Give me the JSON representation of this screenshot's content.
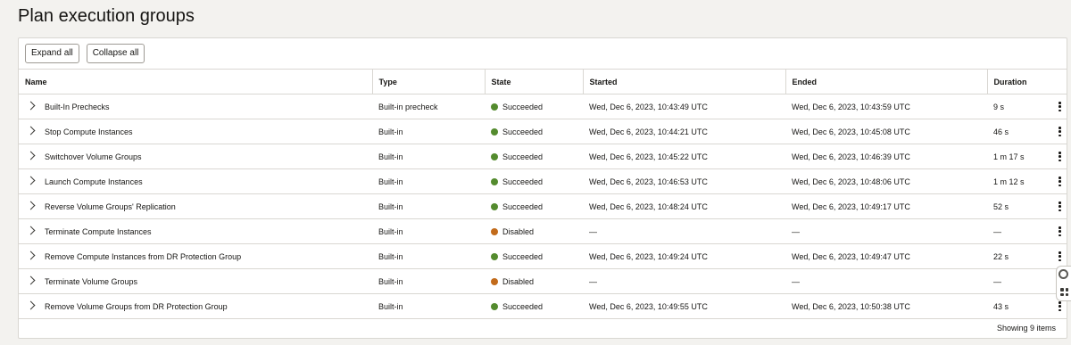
{
  "page": {
    "title": "Plan execution groups"
  },
  "toolbar": {
    "expand_all": "Expand all",
    "collapse_all": "Collapse all"
  },
  "columns": [
    "Name",
    "Type",
    "State",
    "Started",
    "Ended",
    "Duration"
  ],
  "colors": {
    "succeeded": "#548b2e",
    "disabled": "#c26b1b"
  },
  "icons": {
    "expand": "chevron-right-icon",
    "actions": "kebab-menu-icon"
  },
  "rows": [
    {
      "name": "Built-In Prechecks",
      "type": "Built-in precheck",
      "state": "Succeeded",
      "status": "succeeded",
      "started": "Wed, Dec 6, 2023, 10:43:49 UTC",
      "ended": "Wed, Dec 6, 2023, 10:43:59 UTC",
      "duration": "9 s"
    },
    {
      "name": "Stop Compute Instances",
      "type": "Built-in",
      "state": "Succeeded",
      "status": "succeeded",
      "started": "Wed, Dec 6, 2023, 10:44:21 UTC",
      "ended": "Wed, Dec 6, 2023, 10:45:08 UTC",
      "duration": "46 s"
    },
    {
      "name": "Switchover Volume Groups",
      "type": "Built-in",
      "state": "Succeeded",
      "status": "succeeded",
      "started": "Wed, Dec 6, 2023, 10:45:22 UTC",
      "ended": "Wed, Dec 6, 2023, 10:46:39 UTC",
      "duration": "1 m 17 s"
    },
    {
      "name": "Launch Compute Instances",
      "type": "Built-in",
      "state": "Succeeded",
      "status": "succeeded",
      "started": "Wed, Dec 6, 2023, 10:46:53 UTC",
      "ended": "Wed, Dec 6, 2023, 10:48:06 UTC",
      "duration": "1 m 12 s"
    },
    {
      "name": "Reverse Volume Groups' Replication",
      "type": "Built-in",
      "state": "Succeeded",
      "status": "succeeded",
      "started": "Wed, Dec 6, 2023, 10:48:24 UTC",
      "ended": "Wed, Dec 6, 2023, 10:49:17 UTC",
      "duration": "52 s"
    },
    {
      "name": "Terminate Compute Instances",
      "type": "Built-in",
      "state": "Disabled",
      "status": "disabled",
      "started": "—",
      "ended": "—",
      "duration": "—"
    },
    {
      "name": "Remove Compute Instances from DR Protection Group",
      "type": "Built-in",
      "state": "Succeeded",
      "status": "succeeded",
      "started": "Wed, Dec 6, 2023, 10:49:24 UTC",
      "ended": "Wed, Dec 6, 2023, 10:49:47 UTC",
      "duration": "22 s"
    },
    {
      "name": "Terminate Volume Groups",
      "type": "Built-in",
      "state": "Disabled",
      "status": "disabled",
      "started": "—",
      "ended": "—",
      "duration": "—"
    },
    {
      "name": "Remove Volume Groups from DR Protection Group",
      "type": "Built-in",
      "state": "Succeeded",
      "status": "succeeded",
      "started": "Wed, Dec 6, 2023, 10:49:55 UTC",
      "ended": "Wed, Dec 6, 2023, 10:50:38 UTC",
      "duration": "43 s"
    }
  ],
  "footer": {
    "count_text": "Showing 9 items"
  }
}
